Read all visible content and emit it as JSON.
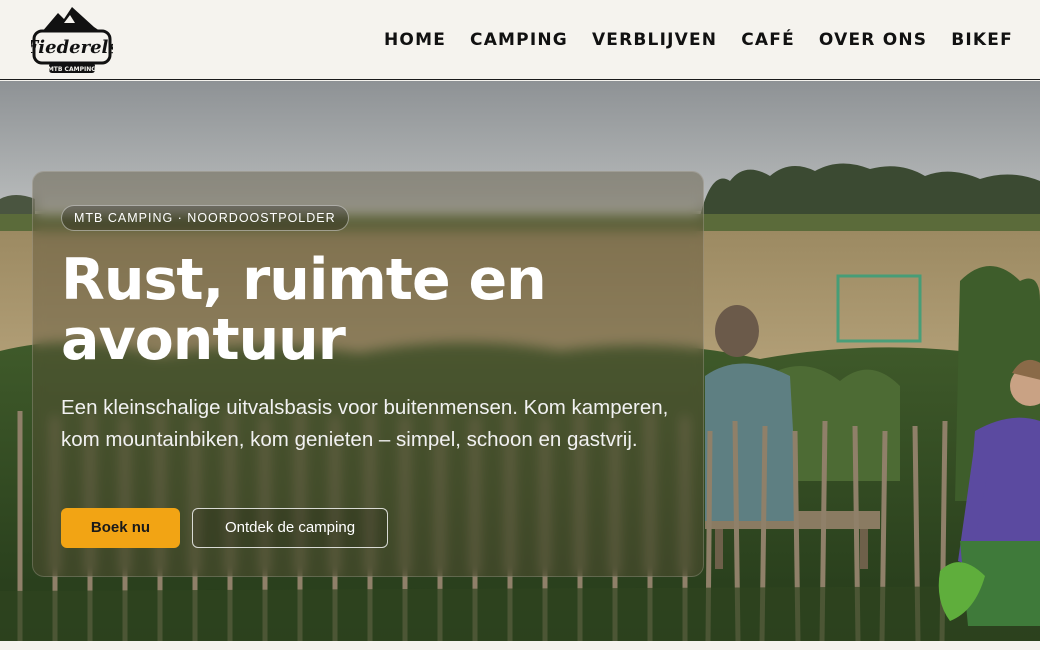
{
  "brand": {
    "logo_text": "Fiederels",
    "logo_subtext": "MTB CAMPING"
  },
  "nav": {
    "items": [
      "HOME",
      "CAMPING",
      "VERBLIJVEN",
      "CAFÉ",
      "OVER ONS",
      "BIKEF"
    ]
  },
  "hero": {
    "badge": "MTB CAMPING · NOORDOOSTPOLDER",
    "title_line1": "Rust, ruimte en",
    "title_line2": "avontuur",
    "subtitle": "Een kleinschalige uitvalsbasis voor buitenmensen. Kom kamperen, kom mountainbiken, kom genieten – simpel, schoon en gastvrij.",
    "primary_button": "Boek nu",
    "secondary_button": "Ontdek de camping"
  },
  "colors": {
    "accent": "#f2a414",
    "header_bg": "#f5f3ee"
  }
}
